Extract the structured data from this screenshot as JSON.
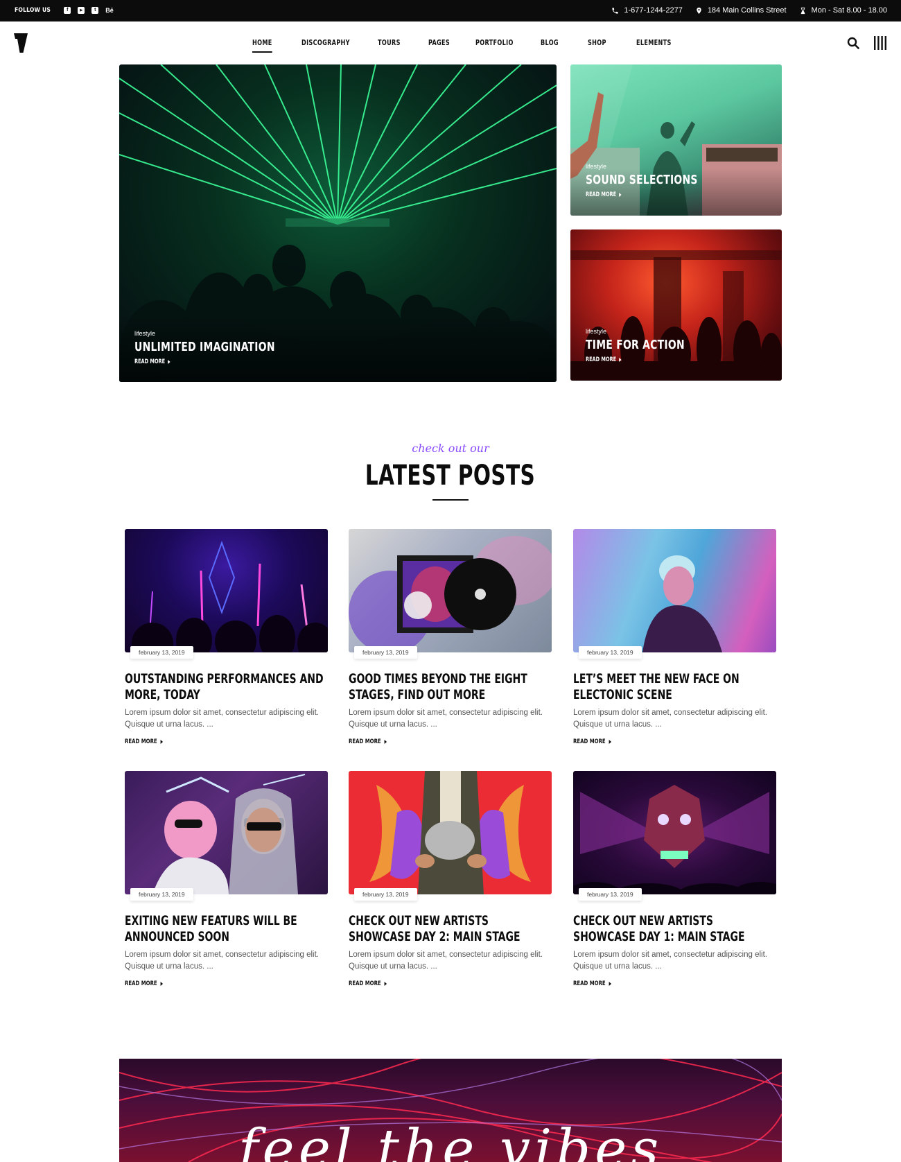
{
  "topbar": {
    "follow_label": "FOLLOW US",
    "social": [
      {
        "icon": "facebook-icon",
        "glyph": "f"
      },
      {
        "icon": "youtube-icon",
        "glyph": "▶"
      },
      {
        "icon": "twitter-icon",
        "glyph": "t"
      },
      {
        "icon": "behance-icon",
        "glyph": "Bē"
      }
    ],
    "phone": "1-677-1244-2277",
    "address": "184 Main Collins Street",
    "hours": "Mon - Sat 8.00 - 18.00"
  },
  "nav": {
    "items": [
      "HOME",
      "DISCOGRAPHY",
      "TOURS",
      "PAGES",
      "PORTFOLIO",
      "BLOG",
      "SHOP",
      "ELEMENTS"
    ],
    "active_index": 0
  },
  "hero": {
    "main": {
      "category": "lifestyle",
      "title": "UNLIMITED IMAGINATION",
      "more": "READ MORE"
    },
    "side": [
      {
        "category": "lifestyle",
        "title": "SOUND SELECTIONS",
        "more": "READ MORE"
      },
      {
        "category": "lifestyle",
        "title": "TIME FOR ACTION",
        "more": "READ MORE"
      }
    ]
  },
  "latest": {
    "kicker": "check out our",
    "title": "LATEST POSTS"
  },
  "posts": [
    {
      "date": "february 13, 2019",
      "title": "OUTSTANDING PERFORMANCES AND MORE, TODAY",
      "excerpt": "Lorem ipsum dolor sit amet, consectetur adipiscing elit. Quisque ut urna lacus. ...",
      "more": "READ MORE"
    },
    {
      "date": "february 13, 2019",
      "title": "GOOD TIMES BEYOND THE EIGHT STAGES, FIND OUT MORE",
      "excerpt": "Lorem ipsum dolor sit amet, consectetur adipiscing elit. Quisque ut urna lacus. ...",
      "more": "READ MORE"
    },
    {
      "date": "february 13, 2019",
      "title": "LET’S MEET THE NEW FACE ON ELECTONIC SCENE",
      "excerpt": "Lorem ipsum dolor sit amet, consectetur adipiscing elit. Quisque ut urna lacus. ...",
      "more": "READ MORE"
    },
    {
      "date": "february 13, 2019",
      "title": "EXITING NEW FEATURS WILL BE ANNOUNCED SOON",
      "excerpt": "Lorem ipsum dolor sit amet, consectetur adipiscing elit. Quisque ut urna lacus. ...",
      "more": "READ MORE"
    },
    {
      "date": "february 13, 2019",
      "title": "CHECK OUT NEW ARTISTS SHOWCASE DAY 2: MAIN STAGE",
      "excerpt": "Lorem ipsum dolor sit amet, consectetur adipiscing elit. Quisque ut urna lacus. ...",
      "more": "READ MORE"
    },
    {
      "date": "february 13, 2019",
      "title": "CHECK OUT NEW ARTISTS SHOWCASE DAY 1: MAIN STAGE",
      "excerpt": "Lorem ipsum dolor sit amet, consectetur adipiscing elit. Quisque ut urna lacus. ...",
      "more": "READ MORE"
    }
  ],
  "banner": {
    "text": "feel the vibes"
  },
  "colors": {
    "accent": "#8a4cff",
    "dark": "#0c0c0c"
  }
}
